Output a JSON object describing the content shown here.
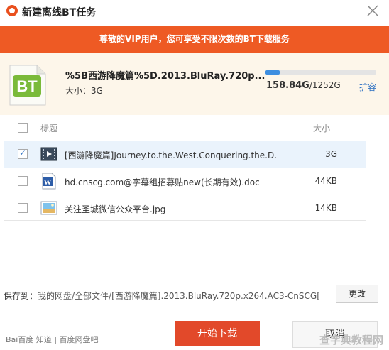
{
  "window": {
    "title": "新建离线BT任务",
    "close_icon": "close-icon"
  },
  "banner": {
    "text": "尊敬的VIP用户，您可享受不限次数的BT下载服务"
  },
  "torrent": {
    "icon_text": "BT",
    "name": "%5B西游降魔篇%5D.2013.BluRay.720p...",
    "size": "大小：3G",
    "quota_used": "158.84G",
    "quota_total": "/1252G",
    "quota_fraction": 0.127,
    "expand_label": "扩容"
  },
  "list": {
    "header_title": "标题",
    "header_size": "大小",
    "rows": [
      {
        "name": "[西游降魔篇]Journey.to.the.West.Conquering.the.D...",
        "size": "3G",
        "checked": true,
        "icon": "video-file-icon"
      },
      {
        "name": "hd.cnscg.com@字幕组招募贴new(长期有效).doc",
        "size": "44KB",
        "checked": false,
        "icon": "word-doc-icon"
      },
      {
        "name": "关注圣城微信公众平台.jpg",
        "size": "14KB",
        "checked": false,
        "icon": "image-file-icon"
      }
    ]
  },
  "save": {
    "label": "保存到：",
    "path": "我的网盘/全部文件/[西游降魔篇].2013.BluRay.720p.x264.AC3-CnSCG[...",
    "change_label": "更改"
  },
  "footer": {
    "watermark": "Bai百度 知道 | 百度网盘吧",
    "start_label": "开始下载",
    "cancel_label": "取消",
    "watermark_right": "查字典教程网"
  },
  "colors": {
    "accent": "#ee5a24",
    "button": "#e2492a",
    "link": "#2b6fc2"
  }
}
